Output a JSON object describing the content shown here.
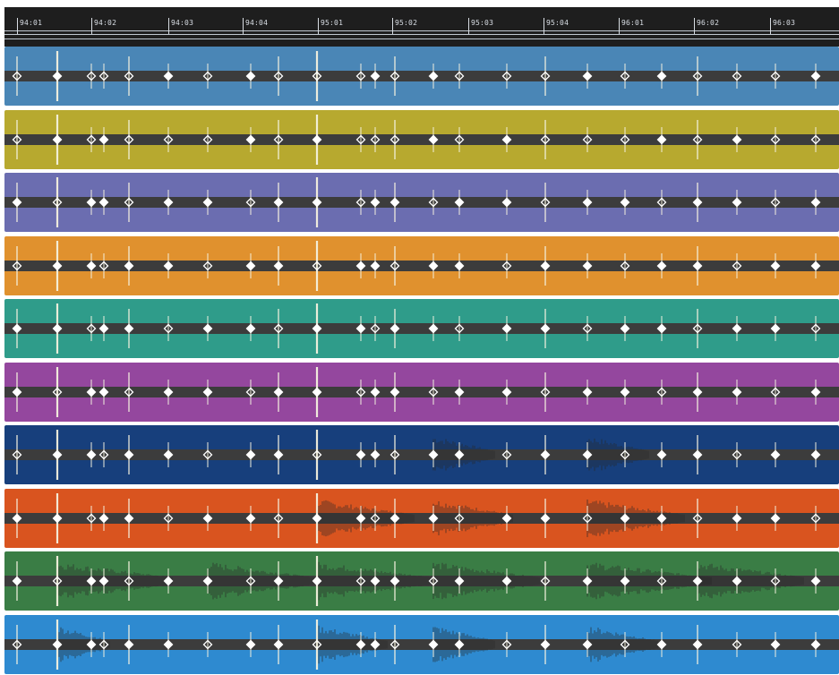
{
  "timeline": {
    "markers": [
      "94:01",
      "94:02",
      "94:03",
      "94:04",
      "95:01",
      "95:02",
      "95:03",
      "95:04",
      "96:01",
      "96:02",
      "96:03"
    ]
  },
  "lane_colors": [
    "#4a86b6",
    "#b7a92f",
    "#6b6db0",
    "#e0912e",
    "#2f9c8a",
    "#94479e",
    "#173f7c",
    "#d9541f",
    "#3a7d45",
    "#2e8ad0"
  ],
  "accent": "#1e1e1e"
}
